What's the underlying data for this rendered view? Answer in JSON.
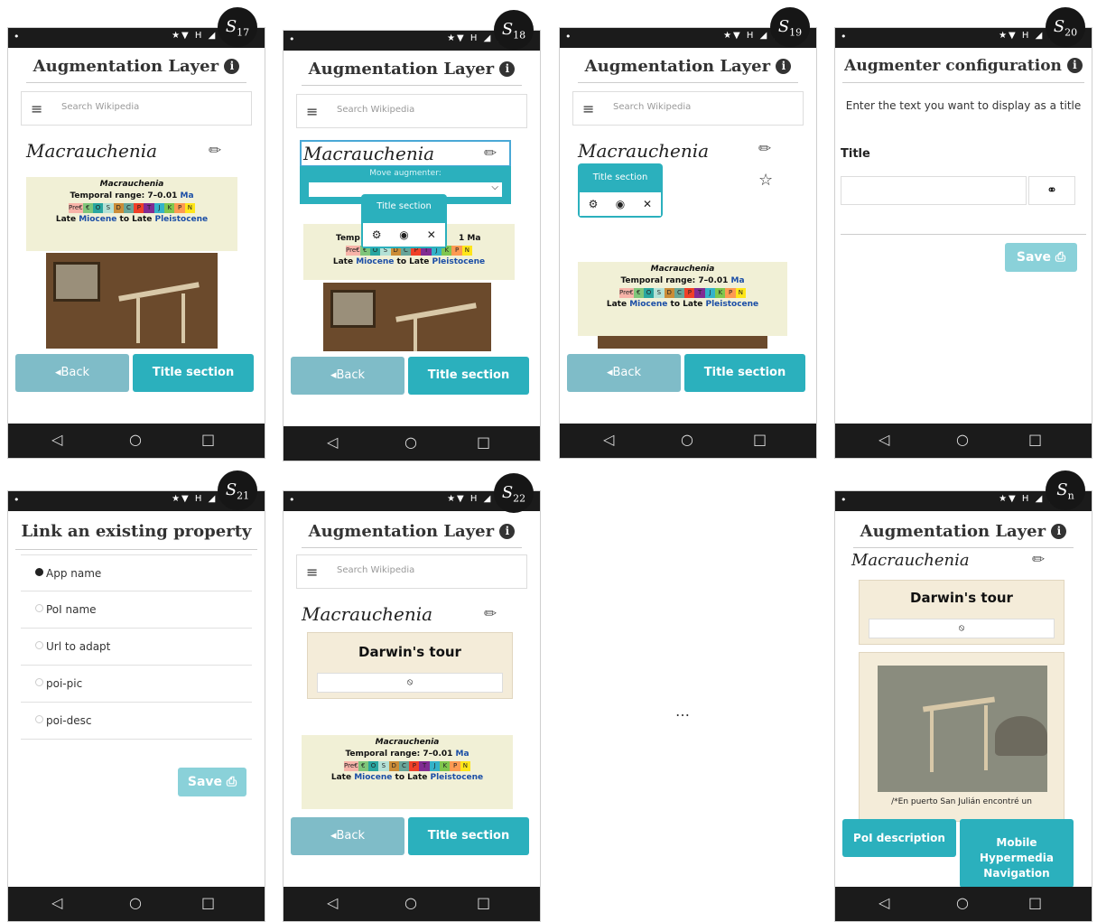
{
  "common": {
    "augmentation_title": "Augmentation Layer",
    "info_glyph": "i",
    "search_placeholder": "Search Wikipedia",
    "article_title": "Macrauchenia",
    "back_label": "◂Back",
    "title_section_label": "Title section",
    "nav_back": "◁",
    "nav_home": "○",
    "nav_recent": "□",
    "status_icons": "★▼ H ◢ ▮",
    "status_pin": "•",
    "menu_glyph": "≡",
    "pencil_glyph": "✏"
  },
  "infobox": {
    "name": "Macrauchenia",
    "range_text": "Temporal range: 7–0.01",
    "range_unit": "Ma",
    "timescale": [
      "Pre€",
      "€",
      "O",
      "S",
      "D",
      "C",
      "P",
      "T",
      "J",
      "K",
      "P",
      "N"
    ],
    "epoch_pre": "Late",
    "epoch_a": "Miocene",
    "epoch_mid": "to Late",
    "epoch_b": "Pleistocene"
  },
  "screens": {
    "s17": {
      "badge": "S",
      "badge_sub": "17"
    },
    "s18": {
      "badge": "S",
      "badge_sub": "18",
      "move_label": "Move augmenter:",
      "select_arrow": "⌵",
      "popup_title": "Title section",
      "ops": [
        "⚙",
        "◉",
        "✕"
      ],
      "cut_text": "Temp",
      "cut_text_right": "1 Ma"
    },
    "s19": {
      "badge": "S",
      "badge_sub": "19",
      "popup_title": "Title section",
      "ops": [
        "⚙",
        "◉",
        "✕"
      ],
      "star": "☆"
    },
    "s20": {
      "badge": "S",
      "badge_sub": "20",
      "header": "Augmenter configuration",
      "instruction": "Enter the text you want to display as a title",
      "field_label": "Title",
      "link_glyph": "⚭",
      "save_label": "Save ⎙"
    },
    "s21": {
      "badge": "S",
      "badge_sub": "21",
      "header": "Link an existing property",
      "options": [
        "App name",
        "PoI name",
        "Url to adapt",
        "poi-pic",
        "poi-desc"
      ],
      "selected_index": 0,
      "save_label": "Save ⎙"
    },
    "s22": {
      "badge": "S",
      "badge_sub": "22",
      "darwin_title": "Darwin's tour",
      "eye_glyph": "⦸"
    },
    "sn": {
      "badge": "S",
      "badge_sub": "n",
      "darwin_title": "Darwin's tour",
      "eye_glyph": "⦸",
      "caption": "/*En puerto San Julián encontré un",
      "poi_desc_label": "PoI description",
      "mobile_nav_label": "Mobile Hypermedia Navigation"
    }
  },
  "ellipsis": "…"
}
